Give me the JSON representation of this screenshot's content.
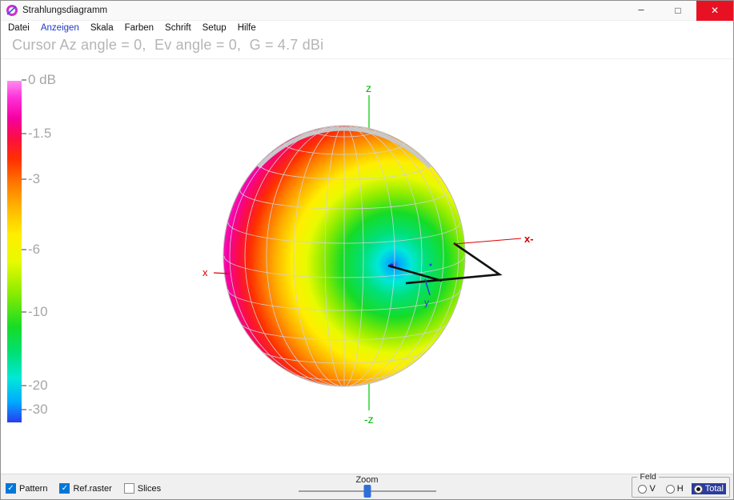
{
  "window": {
    "title": "Strahlungsdiagramm",
    "controls": {
      "minimize": "–",
      "maximize": "□",
      "close": "✕"
    }
  },
  "menu": {
    "items": [
      {
        "label": "Datei"
      },
      {
        "label": "Anzeigen"
      },
      {
        "label": "Skala"
      },
      {
        "label": "Farben"
      },
      {
        "label": "Schrift"
      },
      {
        "label": "Setup"
      },
      {
        "label": "Hilfe"
      }
    ]
  },
  "header": {
    "cursor_text": "Cursor Az angle = 0,  Ev angle = 0,  G = 4.7 dBi"
  },
  "scale": {
    "labels": [
      "0 dB",
      "-1.5",
      "-3",
      "-6",
      "-10",
      "-20",
      "-30"
    ]
  },
  "axes": {
    "z_top": "z",
    "z_bottom": "-z",
    "x_left": "x",
    "x_right": "x-",
    "y_label": "y"
  },
  "bottom": {
    "checkboxes": [
      {
        "label": "Pattern",
        "checked": true
      },
      {
        "label": "Ref.raster",
        "checked": true
      },
      {
        "label": "Slices",
        "checked": false
      }
    ],
    "check_glyph": "✓",
    "zoom_label": "Zoom",
    "feld": {
      "legend": "Feld",
      "options": [
        {
          "label": "V",
          "selected": false
        },
        {
          "label": "H",
          "selected": false
        },
        {
          "label": "Total",
          "selected": true
        }
      ]
    }
  },
  "colors": {
    "close_button": "#e81123",
    "checkbox_checked": "#0078d7",
    "selected_option_bg": "#2b3c9e",
    "z_axis": "#00b400",
    "x_axis": "#e00000",
    "y_axis": "#2244dd"
  },
  "chart_data": {
    "type": "3d-radiation-pattern",
    "gain_dbi": 4.7,
    "cursor": {
      "az_angle": 0,
      "ev_angle": 0
    },
    "scale_db": [
      0,
      -1.5,
      -3,
      -6,
      -10,
      -20,
      -30
    ],
    "field_component": "Total"
  }
}
